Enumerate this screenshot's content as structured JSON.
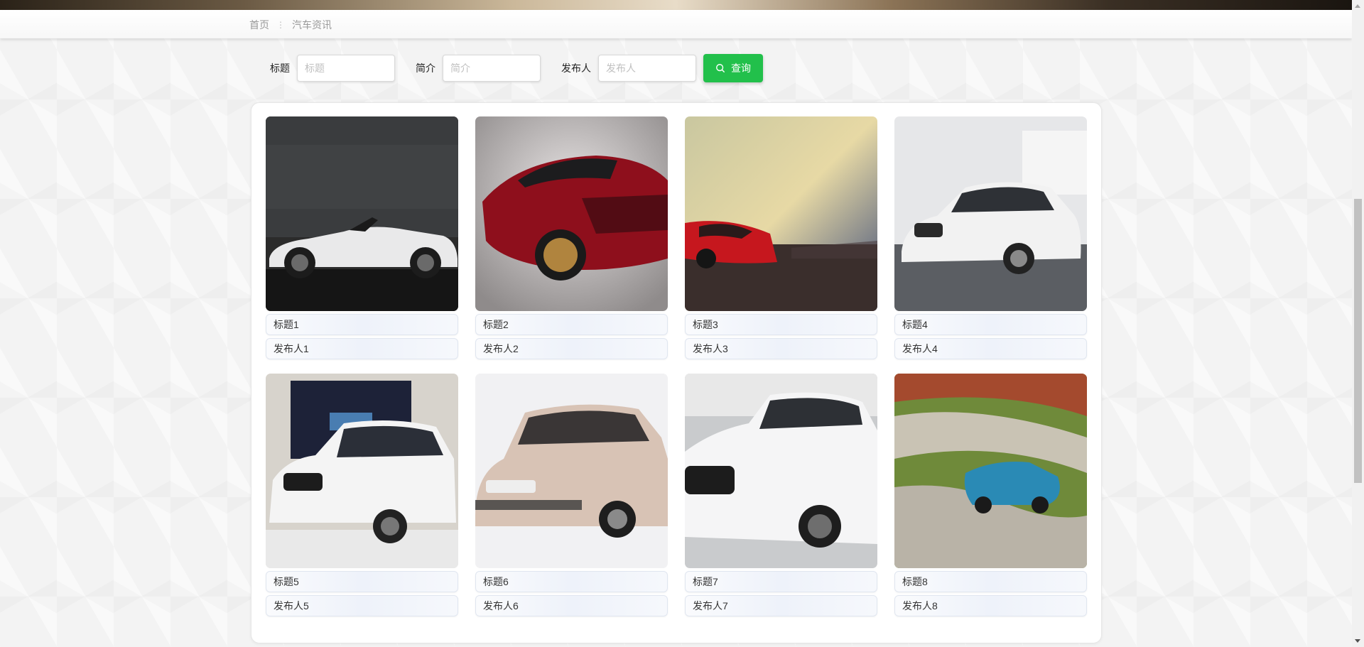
{
  "breadcrumb": {
    "home": "首页",
    "separator": "⋮",
    "current": "汽车资讯"
  },
  "search": {
    "title_label": "标题",
    "title_placeholder": "标题",
    "title_value": "",
    "intro_label": "简介",
    "intro_placeholder": "简介",
    "intro_value": "",
    "publisher_label": "发布人",
    "publisher_placeholder": "发布人",
    "publisher_value": "",
    "button_label": "查询",
    "button_icon": "search-icon",
    "button_color": "#22c04b"
  },
  "cards": [
    {
      "title": "标题1",
      "publisher": "发布人1",
      "image": "white-convertible-photo"
    },
    {
      "title": "标题2",
      "publisher": "发布人2",
      "image": "red-supercar-photo"
    },
    {
      "title": "标题3",
      "publisher": "发布人3",
      "image": "red-sportscar-sunset-photo"
    },
    {
      "title": "标题4",
      "publisher": "发布人4",
      "image": "white-bmw-sedan-photo"
    },
    {
      "title": "标题5",
      "publisher": "发布人5",
      "image": "white-bmw-suv-photo"
    },
    {
      "title": "标题6",
      "publisher": "发布人6",
      "image": "beige-hatchback-photo"
    },
    {
      "title": "标题7",
      "publisher": "发布人7",
      "image": "white-mercedes-suv-photo"
    },
    {
      "title": "标题8",
      "publisher": "发布人8",
      "image": "blue-roadster-track-photo"
    }
  ]
}
